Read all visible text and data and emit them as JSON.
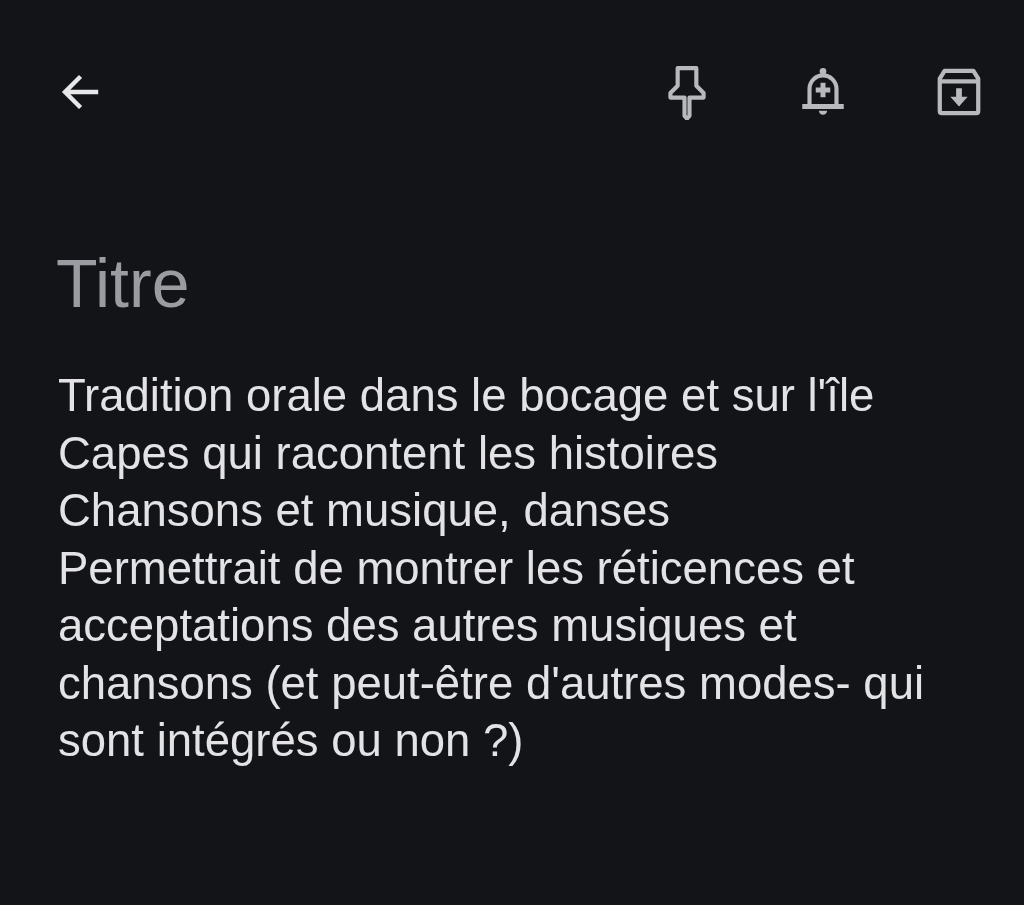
{
  "toolbar": {
    "actions": [
      {
        "kind": "pin"
      },
      {
        "kind": "reminder"
      },
      {
        "kind": "archive"
      }
    ]
  },
  "note": {
    "title": {
      "placeholder": "Titre"
    },
    "body": {
      "lines": [
        "Tradition orale dans le bocage et sur l'île",
        "Capes qui racontent les histoires",
        "Chansons et musique, danses",
        "Permettrait de montrer les réticences et acceptations des autres musiques et chansons (et peut-être d'autres modes- qui sont intégrés ou non ?)"
      ]
    }
  }
}
